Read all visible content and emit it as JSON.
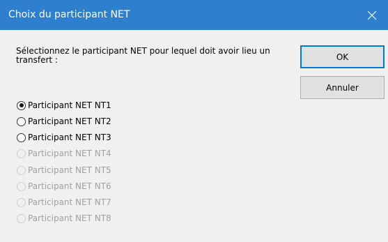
{
  "window": {
    "title": "Choix du participant NET",
    "close_icon": "close-icon",
    "accent_color": "#2f7fcf"
  },
  "prompt": "Sélectionnez le participant NET pour lequel doit avoir lieu un transfert :",
  "buttons": {
    "ok_label": "OK",
    "cancel_label": "Annuler"
  },
  "options": [
    {
      "label": "Participant NET NT1",
      "checked": true,
      "enabled": true
    },
    {
      "label": "Participant NET NT2",
      "checked": false,
      "enabled": true
    },
    {
      "label": "Participant NET NT3",
      "checked": false,
      "enabled": true
    },
    {
      "label": "Participant NET NT4",
      "checked": false,
      "enabled": false
    },
    {
      "label": "Participant NET NT5",
      "checked": false,
      "enabled": false
    },
    {
      "label": "Participant NET NT6",
      "checked": false,
      "enabled": false
    },
    {
      "label": "Participant NET NT7",
      "checked": false,
      "enabled": false
    },
    {
      "label": "Participant NET NT8",
      "checked": false,
      "enabled": false
    }
  ]
}
